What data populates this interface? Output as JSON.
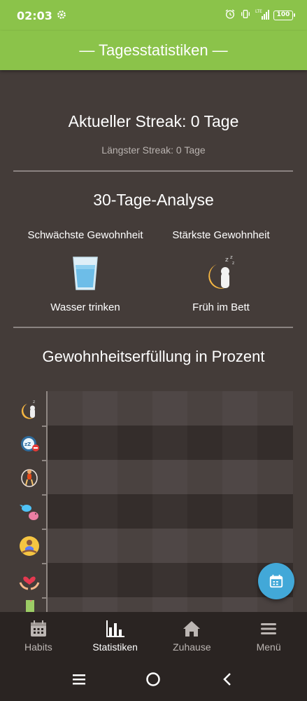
{
  "status": {
    "time": "02:03",
    "battery": "100",
    "network": "LTE"
  },
  "appbar": {
    "title": "— Tagesstatistiken —"
  },
  "streak": {
    "current": "Aktueller Streak: 0 Tage",
    "longest": "Längster Streak: 0 Tage"
  },
  "analysis": {
    "title": "30-Tage-Analyse",
    "weakest": {
      "label": "Schwächste Gewohnheit",
      "habit": "Wasser trinken",
      "icon": "water-glass-icon"
    },
    "strongest": {
      "label": "Stärkste Gewohnheit",
      "habit": "Früh im Bett",
      "icon": "sleeping-moon-icon"
    }
  },
  "chart_section": {
    "title": "Gewohnheitserfüllung in Prozent",
    "habit_icons": [
      "sleeping-moon-icon",
      "alarm-clock-icon",
      "jump-rope-icon",
      "birds-icon",
      "meditation-icon",
      "heart-hands-icon",
      "drink-icon"
    ]
  },
  "bottom_nav": {
    "items": [
      {
        "label": "Habits",
        "icon": "calendar-icon"
      },
      {
        "label": "Statistiken",
        "icon": "bar-chart-icon",
        "active": true
      },
      {
        "label": "Zuhause",
        "icon": "home-icon"
      },
      {
        "label": "Menü",
        "icon": "hamburger-icon"
      }
    ]
  },
  "colors": {
    "accent": "#8bc34a",
    "background": "#443c39",
    "fab": "#42a8d8",
    "nav": "#2a2422"
  }
}
